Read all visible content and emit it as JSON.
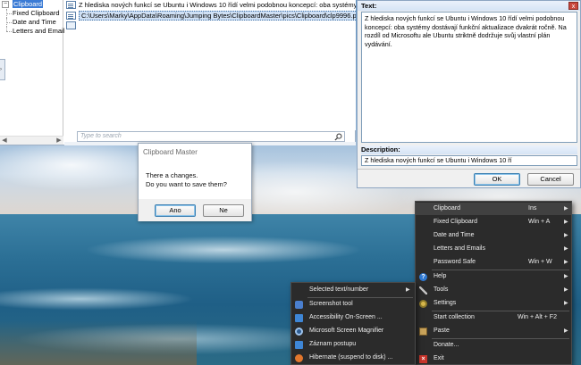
{
  "tree": {
    "items": [
      "Clipboard",
      "Fixed Clipboard",
      "Date and Time",
      "Letters and Emails"
    ]
  },
  "list": {
    "rows": [
      "Z hlediska nových funkcí se Ubuntu i Windows 10 řídí velmi podobnou koncepcí: oba systémy dostává",
      "C:\\Users\\Marky\\AppData\\Roaming\\Jumping Bytes\\ClipboardMaster\\pics\\Clipboard\\clp9996.png"
    ],
    "search_placeholder": "Type to search"
  },
  "textpanel": {
    "text_label": "Text:",
    "text": "Z hlediska nových funkcí se Ubuntu i Windows 10 řídí velmi podobnou koncepcí: oba systémy dostávají funkční aktualizace dvakrát ročně. Na rozdíl od Microsoftu ale Ubuntu striktně dodržuje svůj vlastní plán vydávání.",
    "description_label": "Description:",
    "description": "Z hlediska nových funkcí se Ubuntu i Windows 10 ří",
    "ok": "OK",
    "cancel": "Cancel"
  },
  "dialog": {
    "title": "Clipboard Master",
    "line1": "There a changes.",
    "line2": "Do you want to save them?",
    "yes": "Ano",
    "no": "Ne"
  },
  "main_menu": [
    {
      "label": "Clipboard",
      "shortcut": "Ins",
      "submenu": true,
      "highlight": true
    },
    {
      "label": "Fixed Clipboard",
      "shortcut": "Win + A",
      "submenu": true
    },
    {
      "label": "Date and Time",
      "shortcut": "",
      "submenu": true
    },
    {
      "label": "Letters and Emails",
      "shortcut": "",
      "submenu": true
    },
    {
      "label": "Password Safe",
      "shortcut": "Win + W",
      "submenu": true
    },
    {
      "label": "Help",
      "shortcut": "",
      "submenu": true,
      "icon": "help-icon"
    },
    {
      "label": "Tools",
      "shortcut": "",
      "submenu": true,
      "icon": "tools-icon"
    },
    {
      "label": "Settings",
      "shortcut": "",
      "submenu": true,
      "icon": "settings-icon"
    },
    {
      "label": "Start collection",
      "shortcut": "Win + Alt + F2",
      "submenu": false
    },
    {
      "label": "Paste",
      "shortcut": "",
      "submenu": true,
      "icon": "paste-icon"
    },
    {
      "label": "Donate...",
      "shortcut": "",
      "submenu": false
    },
    {
      "label": "Exit",
      "shortcut": "",
      "submenu": false,
      "icon": "exit-icon"
    }
  ],
  "tools_menu": [
    {
      "label": "Selected text/number",
      "submenu": true
    },
    {
      "label": "Screenshot tool",
      "icon": "camera-icon"
    },
    {
      "label": "Accessibility On-Screen ...",
      "icon": "keyboard-icon"
    },
    {
      "label": "Microsoft Screen Magnifier",
      "icon": "magnifier-icon"
    },
    {
      "label": "Záznam postupu",
      "icon": "steps-recorder-icon"
    },
    {
      "label": "Hibernate (suspend to disk) ...",
      "icon": "hibernate-icon"
    }
  ]
}
